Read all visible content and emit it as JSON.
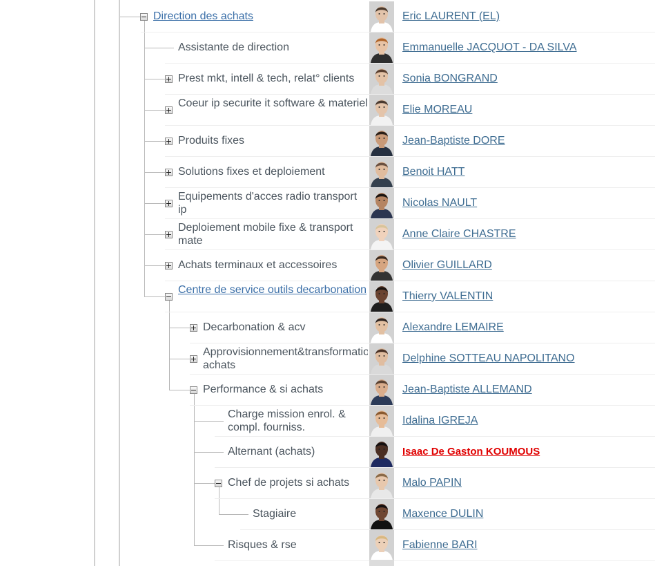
{
  "accent_link_color": "#3f6d92",
  "highlight_color": "#e00000",
  "rows": [
    {
      "label": "Direction des achats",
      "person": "Eric LAURENT (EL)",
      "toggle": "minus",
      "link": true,
      "skin": "#e2c3aa",
      "hair": "#4b3a2d",
      "shirt": "#ffffff"
    },
    {
      "label": "Assistante de direction",
      "person": "Emmanuelle JACQUOT - DA SILVA",
      "toggle": "none",
      "link": false,
      "skin": "#e7c3a5",
      "hair": "#b0652a",
      "shirt": "#2e2e2e"
    },
    {
      "label": "Prest mkt, intell & tech, relat° clients",
      "person": "Sonia BONGRAND",
      "toggle": "plus",
      "link": false,
      "skin": "#e3c2a6",
      "hair": "#5a4030",
      "shirt": "#dcdcdc"
    },
    {
      "label": "Coeur ip securite it software & materiel",
      "person": "Elie MOREAU",
      "toggle": "plus",
      "link": false,
      "skin": "#e4c4aa",
      "hair": "#4a3a30",
      "shirt": "#f2f2f2"
    },
    {
      "label": "Produits fixes",
      "person": "Jean-Baptiste DORE",
      "toggle": "plus",
      "link": false,
      "skin": "#c99a78",
      "hair": "#2a1f18",
      "shirt": "#263040"
    },
    {
      "label": "Solutions fixes et deploiement",
      "person": "Benoit HATT",
      "toggle": "plus",
      "link": false,
      "skin": "#e0bc9e",
      "hair": "#6a5040",
      "shirt": "#34404e"
    },
    {
      "label": "Equipements d'acces radio transport ip",
      "person": "Nicolas NAULT",
      "toggle": "plus",
      "link": false,
      "skin": "#b58462",
      "hair": "#1a1410",
      "shirt": "#2b3550"
    },
    {
      "label": "Deploiement mobile fixe & transport mate",
      "person": "Anne Claire CHASTRE",
      "toggle": "plus",
      "link": false,
      "skin": "#f0d2bc",
      "hair": "#d8c49a",
      "shirt": "#f4f4f4"
    },
    {
      "label": "Achats terminaux et accessoires",
      "person": "Olivier GUILLARD",
      "toggle": "plus",
      "link": false,
      "skin": "#d6a580",
      "hair": "#3a2a20",
      "shirt": "#333333"
    },
    {
      "label": "Centre de service outils decarbonation",
      "person": "Thierry VALENTIN",
      "toggle": "minus",
      "link": true,
      "skin": "#6a4330",
      "hair": "#1c1410",
      "shirt": "#1e1e1e"
    },
    {
      "label": "Decarbonation & acv",
      "person": "Alexandre LEMAIRE",
      "toggle": "plus",
      "link": false,
      "skin": "#e2c0a2",
      "hair": "#2e2420",
      "shirt": "#ffffff"
    },
    {
      "label": "Approvisionnement&transformation achats",
      "person": "Delphine SOTTEAU NAPOLITANO",
      "toggle": "plus",
      "link": false,
      "skin": "#e0bda0",
      "hair": "#4a3226",
      "shirt": "#d9d9d9"
    },
    {
      "label": "Performance & si achats",
      "person": "Jean-Baptiste ALLEMAND",
      "toggle": "minus",
      "link": false,
      "skin": "#d9ad8c",
      "hair": "#5a4232",
      "shirt": "#2c3b58"
    },
    {
      "label": "Charge mission enrol. & compl. fourniss.",
      "person": "Idalina IGREJA",
      "toggle": "none",
      "link": false,
      "skin": "#e6bc98",
      "hair": "#8a5a30",
      "shirt": "#f0f0f0"
    },
    {
      "label": "Alternant (achats)",
      "person": "Isaac De Gaston KOUMOUS",
      "toggle": "none",
      "link": false,
      "highlight": true,
      "skin": "#4a2e22",
      "hair": "#141010",
      "shirt": "#1e2a60"
    },
    {
      "label": "Chef de projets si achats",
      "person": "Malo PAPIN",
      "toggle": "minus",
      "link": false,
      "skin": "#e8c8ad",
      "hair": "#8a6a48",
      "shirt": "#e8e8e8"
    },
    {
      "label": "Stagiaire",
      "person": "Maxence DULIN",
      "toggle": "none",
      "link": false,
      "skin": "#6f4632",
      "hair": "#151010",
      "shirt": "#111111"
    },
    {
      "label": "Risques & rse",
      "person": "Fabienne BARI",
      "toggle": "none",
      "link": false,
      "skin": "#ecd0b8",
      "hair": "#d8b880",
      "shirt": "#ffffff"
    }
  ]
}
